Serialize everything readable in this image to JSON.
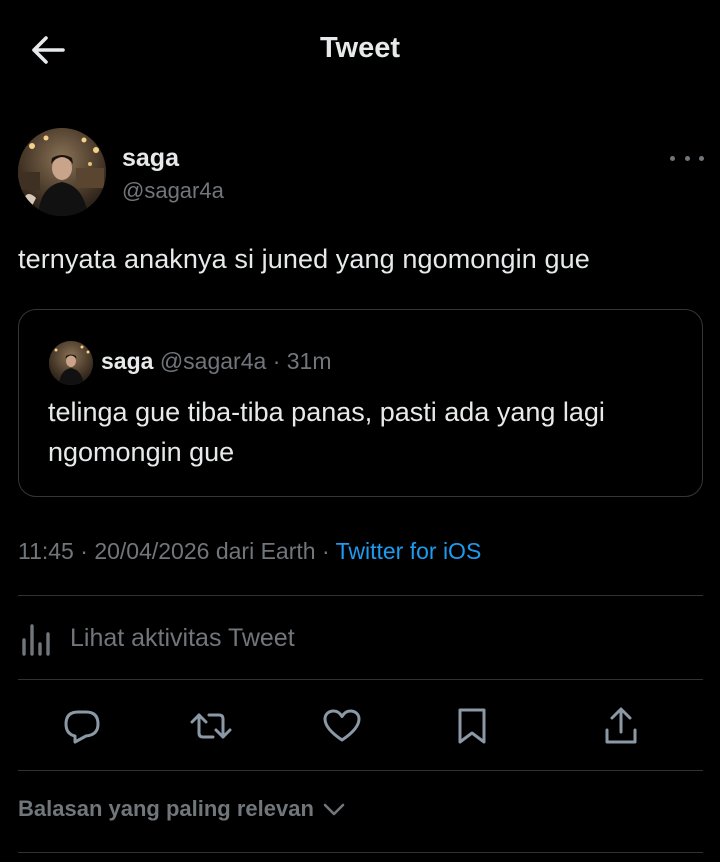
{
  "header": {
    "title": "Tweet"
  },
  "tweet": {
    "author_name": "saga",
    "author_handle": "@sagar4a",
    "text": "ternyata anaknya si juned yang ngomongin gue"
  },
  "quote": {
    "author_name": "saga",
    "author_handle": "@sagar4a",
    "time": "· 31m",
    "text": "telinga gue tiba-tiba panas, pasti ada yang lagi ngomongin gue"
  },
  "meta": {
    "time": "11:45",
    "date": "20/04/2026",
    "location": "dari Earth",
    "separator": "·",
    "source": "Twitter for iOS"
  },
  "activity": {
    "label": "Lihat aktivitas Tweet"
  },
  "sort": {
    "label": "Balasan yang paling relevan"
  },
  "icons": {
    "back": "arrow-left-icon",
    "more": "more-horizontal-icon",
    "analytics": "bar-chart-icon",
    "reply": "reply-icon",
    "retweet": "retweet-icon",
    "like": "heart-icon",
    "bookmark": "bookmark-icon",
    "share": "share-icon",
    "chevron": "chevron-down-icon"
  },
  "colors": {
    "background": "#000000",
    "text": "#e7e9ea",
    "secondary": "#71767b",
    "accent": "#1d9bf0",
    "border": "#2f3336"
  }
}
